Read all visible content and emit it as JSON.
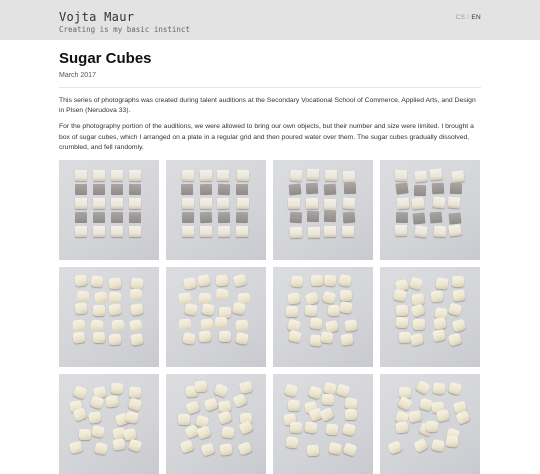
{
  "header": {
    "name": "Vojta Maur",
    "tagline": "Creating is my basic instinct",
    "lang_cs": "CS",
    "lang_sep": "/",
    "lang_en": "EN"
  },
  "article": {
    "title": "Sugar Cubes",
    "date": "March 2017",
    "paragraphs": [
      "This series of photographs was created during talent auditions at the Secondary Vocational School of Commerce, Applied Arts, and Design in Plsen (Nerudova 33).",
      "For the photography portion of the auditions, we were allowed to bring our own objects, but their number and size were limited. I brought a box of sugar cubes, which I arranged on a plate in a regular grid and then poured water over them. The sugar cubes gradually dissolved, crumbled, and fell randomly."
    ]
  },
  "gallery": {
    "photo_count": 12
  }
}
